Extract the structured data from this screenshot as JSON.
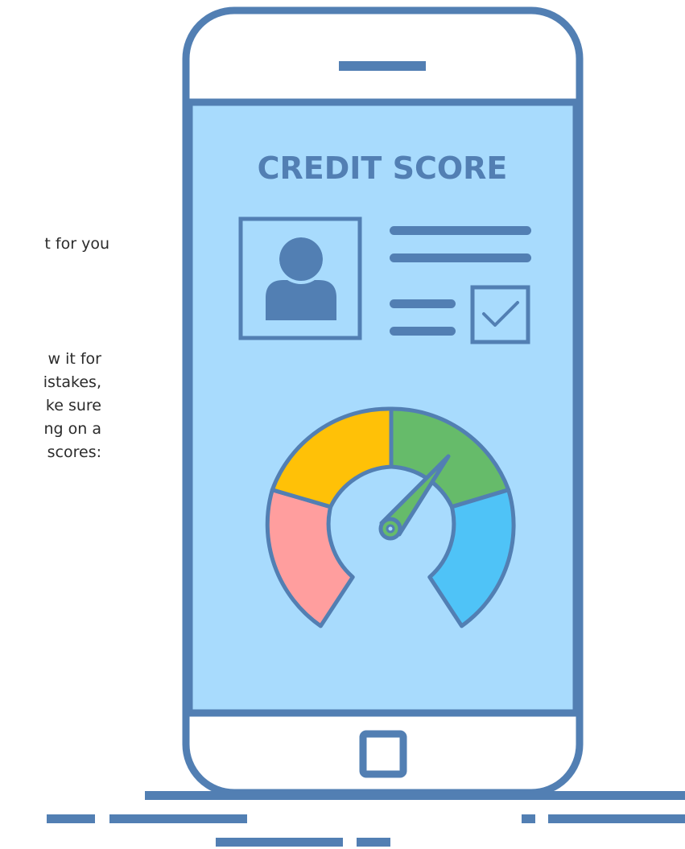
{
  "left_text": {
    "heading_fragment": "t for you",
    "body_lines": [
      "w it for",
      "istakes,",
      "ke sure",
      "ng on a",
      "scores:"
    ]
  },
  "phone": {
    "screen_title": "CREDIT SCORE"
  },
  "colors": {
    "outline": "#527fb3",
    "screen": "#a8dbfd",
    "gauge_red": "#ff9e9e",
    "gauge_yellow": "#ffc107",
    "gauge_green": "#66bb6a",
    "gauge_blue": "#4fc3f7"
  },
  "gauge": {
    "segments": [
      "red",
      "yellow",
      "green",
      "blue"
    ],
    "needle_segment": "green"
  }
}
